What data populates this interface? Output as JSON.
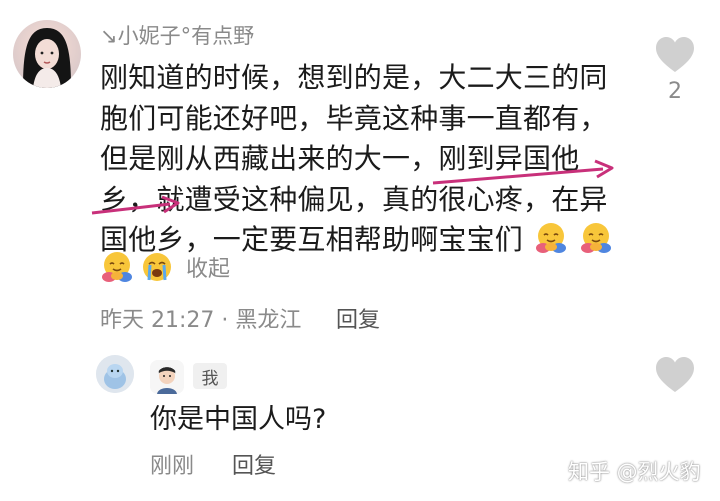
{
  "comment": {
    "author": "↘小妮子°有点野",
    "lines": [
      "刚知道的时候，想到的是，大二大三的同",
      "胞们可能还好吧，毕竟这种事一直都有，",
      "但是刚从西藏出来的大一，刚到异国他",
      "乡，就遭受这种偏见，真的很心疼，在异",
      "国他乡，一定要互相帮助啊宝宝们"
    ],
    "collapse_label": "收起",
    "meta": "昨天 21:27 · 黑龙江",
    "reply_label": "回复",
    "like_count": "2",
    "emojis": [
      "hugging-emoji",
      "hugging-emoji",
      "hugging-emoji",
      "crying-emoji"
    ]
  },
  "reply": {
    "me_badge": "我",
    "text": "你是中国人吗?",
    "time": "刚刚",
    "reply_label": "回复"
  },
  "watermark": "知乎 @烈火豹",
  "colors": {
    "annotation_arrow": "#c8307a",
    "muted_text": "#8a8a8a",
    "like_icon": "#d0d0d0"
  }
}
